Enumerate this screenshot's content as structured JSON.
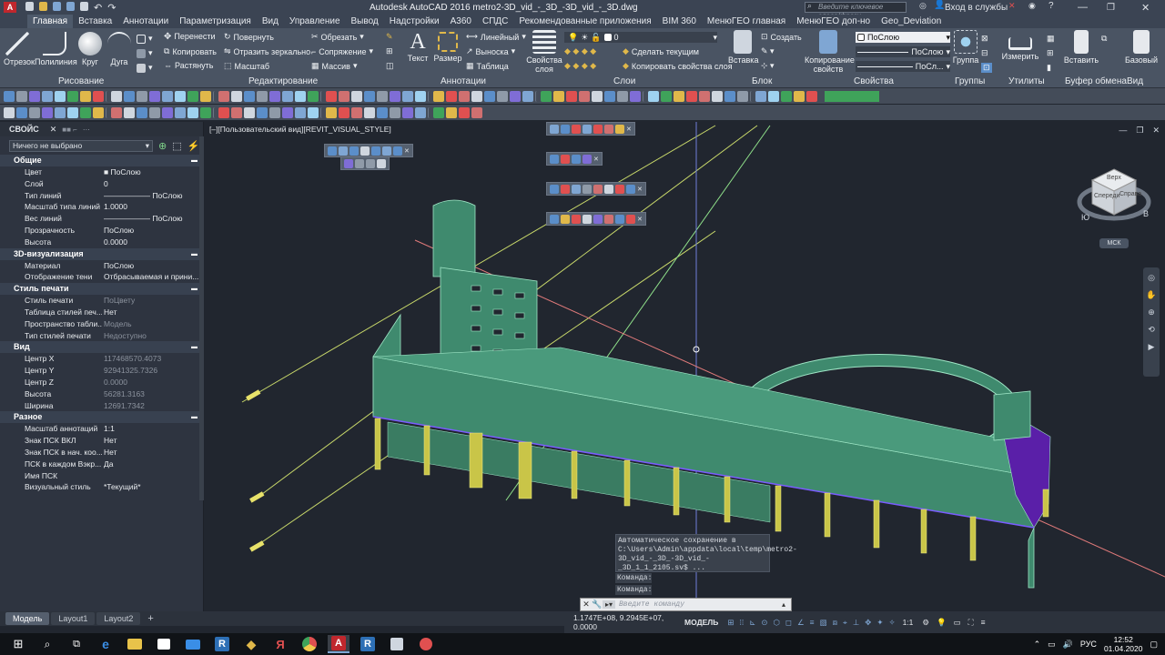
{
  "window": {
    "title": "Autodesk AutoCAD 2016     metro2-3D_vid_-_3D_-3D_vid_-_3D.dwg",
    "search_placeholder": "Введите ключевое слово/фразу",
    "login": "Вход в службы"
  },
  "ribbon_tabs": [
    "Главная",
    "Вставка",
    "Аннотации",
    "Параметризация",
    "Вид",
    "Управление",
    "Вывод",
    "Надстройки",
    "A360",
    "СПДС",
    "Рекомендованные приложения",
    "BIM 360",
    "МенюГЕО главная",
    "МенюГЕО доп-но",
    "Geo_Deviation"
  ],
  "ribbon": {
    "draw": {
      "title": "Рисование",
      "line": "Отрезок",
      "polyline": "Полилиния",
      "circle": "Круг",
      "arc": "Дуга"
    },
    "modify": {
      "title": "Редактирование",
      "move": "Перенести",
      "rotate": "Повернуть",
      "trim": "Обрезать",
      "copy": "Копировать",
      "mirror": "Отразить зеркально",
      "fillet": "Сопряжение",
      "stretch": "Растянуть",
      "scale": "Масштаб",
      "array": "Массив"
    },
    "annot": {
      "title": "Аннотации",
      "text": "Текст",
      "dim": "Размер",
      "linear": "Линейный",
      "leader": "Выноска",
      "table": "Таблица"
    },
    "layers": {
      "title": "Слои",
      "props": "Свойства слоя",
      "current": "0",
      "make_current": "Сделать текущим",
      "match": "Копировать свойства слоя"
    },
    "block": {
      "title": "Блок",
      "insert": "Вставка",
      "create": "Создать"
    },
    "properties": {
      "title": "Свойства",
      "match": "Копирование свойств",
      "bylayer1": "ПоСлою",
      "bylayer2": "ПоСлою",
      "bylayer3": "ПоСл..."
    },
    "groups": {
      "title": "Группы",
      "group": "Группа"
    },
    "utils": {
      "title": "Утилиты",
      "measure": "Измерить"
    },
    "clipboard": {
      "title": "Буфер обмена",
      "paste": "Вставить"
    },
    "view": {
      "title": "Вид",
      "base": "Базовый"
    }
  },
  "properties_panel": {
    "title": "СВОЙС",
    "selection": "Ничего не выбрано",
    "sections": [
      {
        "name": "Общие",
        "rows": [
          [
            "Цвет",
            "■ ПоСлою",
            false
          ],
          [
            "Слой",
            "0",
            false
          ],
          [
            "Тип линий",
            "—————— ПоСлою",
            false
          ],
          [
            "Масштаб типа линий",
            "1.0000",
            false
          ],
          [
            "Вес линий",
            "—————— ПоСлою",
            false
          ],
          [
            "Прозрачность",
            "ПоСлою",
            false
          ],
          [
            "Высота",
            "0.0000",
            false
          ]
        ]
      },
      {
        "name": "3D-визуализация",
        "rows": [
          [
            "Материал",
            "ПоСлою",
            false
          ],
          [
            "Отображение тени",
            "Отбрасываемая и прини...",
            false
          ]
        ]
      },
      {
        "name": "Стиль печати",
        "rows": [
          [
            "Стиль печати",
            "ПоЦвету",
            true
          ],
          [
            "Таблица стилей печ...",
            "Нет",
            false
          ],
          [
            "Пространство табли...",
            "Модель",
            true
          ],
          [
            "Тип стилей печати",
            "Недоступно",
            true
          ]
        ]
      },
      {
        "name": "Вид",
        "rows": [
          [
            "Центр X",
            "117468570.4073",
            true
          ],
          [
            "Центр Y",
            "92941325.7326",
            true
          ],
          [
            "Центр Z",
            "0.0000",
            true
          ],
          [
            "Высота",
            "56281.3163",
            true
          ],
          [
            "Ширина",
            "12691.7342",
            true
          ]
        ]
      },
      {
        "name": "Разное",
        "rows": [
          [
            "Масштаб аннотаций",
            "1:1",
            false
          ],
          [
            "Знак ПСК ВКЛ",
            "Нет",
            false
          ],
          [
            "Знак ПСК в нач. коо...",
            "Нет",
            false
          ],
          [
            "ПСК в каждом Вэкр...",
            "Да",
            false
          ],
          [
            "Имя ПСК",
            "",
            false
          ],
          [
            "Визуальный стиль",
            "*Текущий*",
            false
          ]
        ]
      }
    ]
  },
  "viewport": {
    "label": "[–][Пользовательский вид][REVIT_VISUAL_STYLE]",
    "viewcube_top": "Верх",
    "viewcube_front": "Спереди",
    "viewcube_right": "Справа",
    "compass_s": "Ю",
    "compass_e": "В",
    "ucs": "МСК"
  },
  "command": {
    "history": "Автоматическое сохранение в C:\\Users\\Admin\\appdata\\local\\temp\\metro2-3D_vid_-_3D_-3D_vid_-_3D_1_1_2105.sv$ ...",
    "prompt1": "Команда:",
    "prompt2": "Команда:",
    "placeholder": "Введите команду"
  },
  "layout_tabs": [
    "Модель",
    "Layout1",
    "Layout2"
  ],
  "status": {
    "coords": "1.1747E+08, 9.2945E+07, 0.0000",
    "space": "МОДЕЛЬ",
    "scale": "1:1"
  },
  "taskbar": {
    "lang": "РУС",
    "time": "12:52",
    "date": "01.04.2020"
  },
  "colors": {
    "building": "#3f8a6e",
    "edge": "#9fe6c6",
    "columns": "#c9c548",
    "purple": "#5a1fa8"
  }
}
